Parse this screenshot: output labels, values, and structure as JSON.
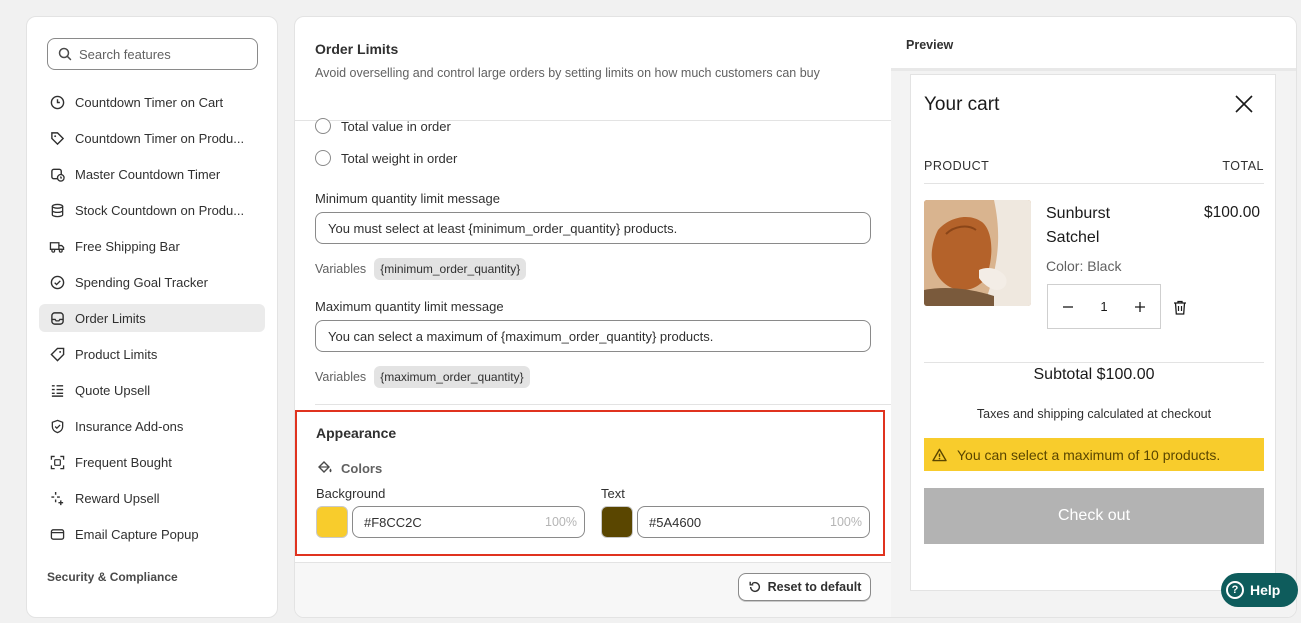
{
  "sidebar": {
    "search_placeholder": "Search features",
    "items": [
      {
        "label": "Countdown Timer on Cart",
        "icon": "clock-icon"
      },
      {
        "label": "Countdown Timer on Produ...",
        "icon": "tag-icon"
      },
      {
        "label": "Master Countdown Timer",
        "icon": "calendar-clock-icon"
      },
      {
        "label": "Stock Countdown on Produ...",
        "icon": "database-icon"
      },
      {
        "label": "Free Shipping Bar",
        "icon": "truck-icon"
      },
      {
        "label": "Spending Goal Tracker",
        "icon": "check-circle-icon"
      },
      {
        "label": "Order Limits",
        "icon": "inbox-icon"
      },
      {
        "label": "Product Limits",
        "icon": "tag-outline-icon"
      },
      {
        "label": "Quote Upsell",
        "icon": "list-icon"
      },
      {
        "label": "Insurance Add-ons",
        "icon": "shield-check-icon"
      },
      {
        "label": "Frequent Bought",
        "icon": "scan-icon"
      },
      {
        "label": "Reward Upsell",
        "icon": "sparkle-icon"
      },
      {
        "label": "Email Capture Popup",
        "icon": "mail-icon"
      }
    ],
    "active_item": "Order Limits",
    "section_label": "Security & Compliance"
  },
  "order_limits": {
    "title": "Order Limits",
    "description": "Avoid overselling and control large orders by setting limits on how much customers can buy",
    "radio_options": [
      "Total value in order",
      "Total weight in order"
    ],
    "min_label": "Minimum quantity limit message",
    "min_value": "You must select at least {minimum_order_quantity} products.",
    "min_vars_label": "Variables",
    "min_var": "{minimum_order_quantity}",
    "max_label": "Maximum quantity limit message",
    "max_value": "You can select a maximum of {maximum_order_quantity} products.",
    "max_vars_label": "Variables",
    "max_var": "{maximum_order_quantity}"
  },
  "appearance": {
    "title": "Appearance",
    "colors_label": "Colors",
    "background_label": "Background",
    "background_hex": "#F8CC2C",
    "background_opacity": "100%",
    "text_label": "Text",
    "text_hex": "#5A4600",
    "text_opacity": "100%"
  },
  "footer": {
    "reset_label": "Reset to default"
  },
  "preview": {
    "title": "Preview",
    "cart_title": "Your cart",
    "col_product": "PRODUCT",
    "col_total": "TOTAL",
    "product_name": "Sunburst Satchel",
    "product_price": "$100.00",
    "product_variant": "Color: Black",
    "quantity": "1",
    "subtotal": "Subtotal $100.00",
    "taxes_note": "Taxes and shipping calculated at checkout",
    "warning": "You can select a maximum of 10 products.",
    "checkout_label": "Check out"
  },
  "help": {
    "label": "Help"
  },
  "colors": {
    "accent_warning_bg": "#F8CC2C",
    "accent_warning_text": "#5A4600",
    "highlight_border": "#E0331F",
    "help_bg": "#0E5C5C"
  }
}
